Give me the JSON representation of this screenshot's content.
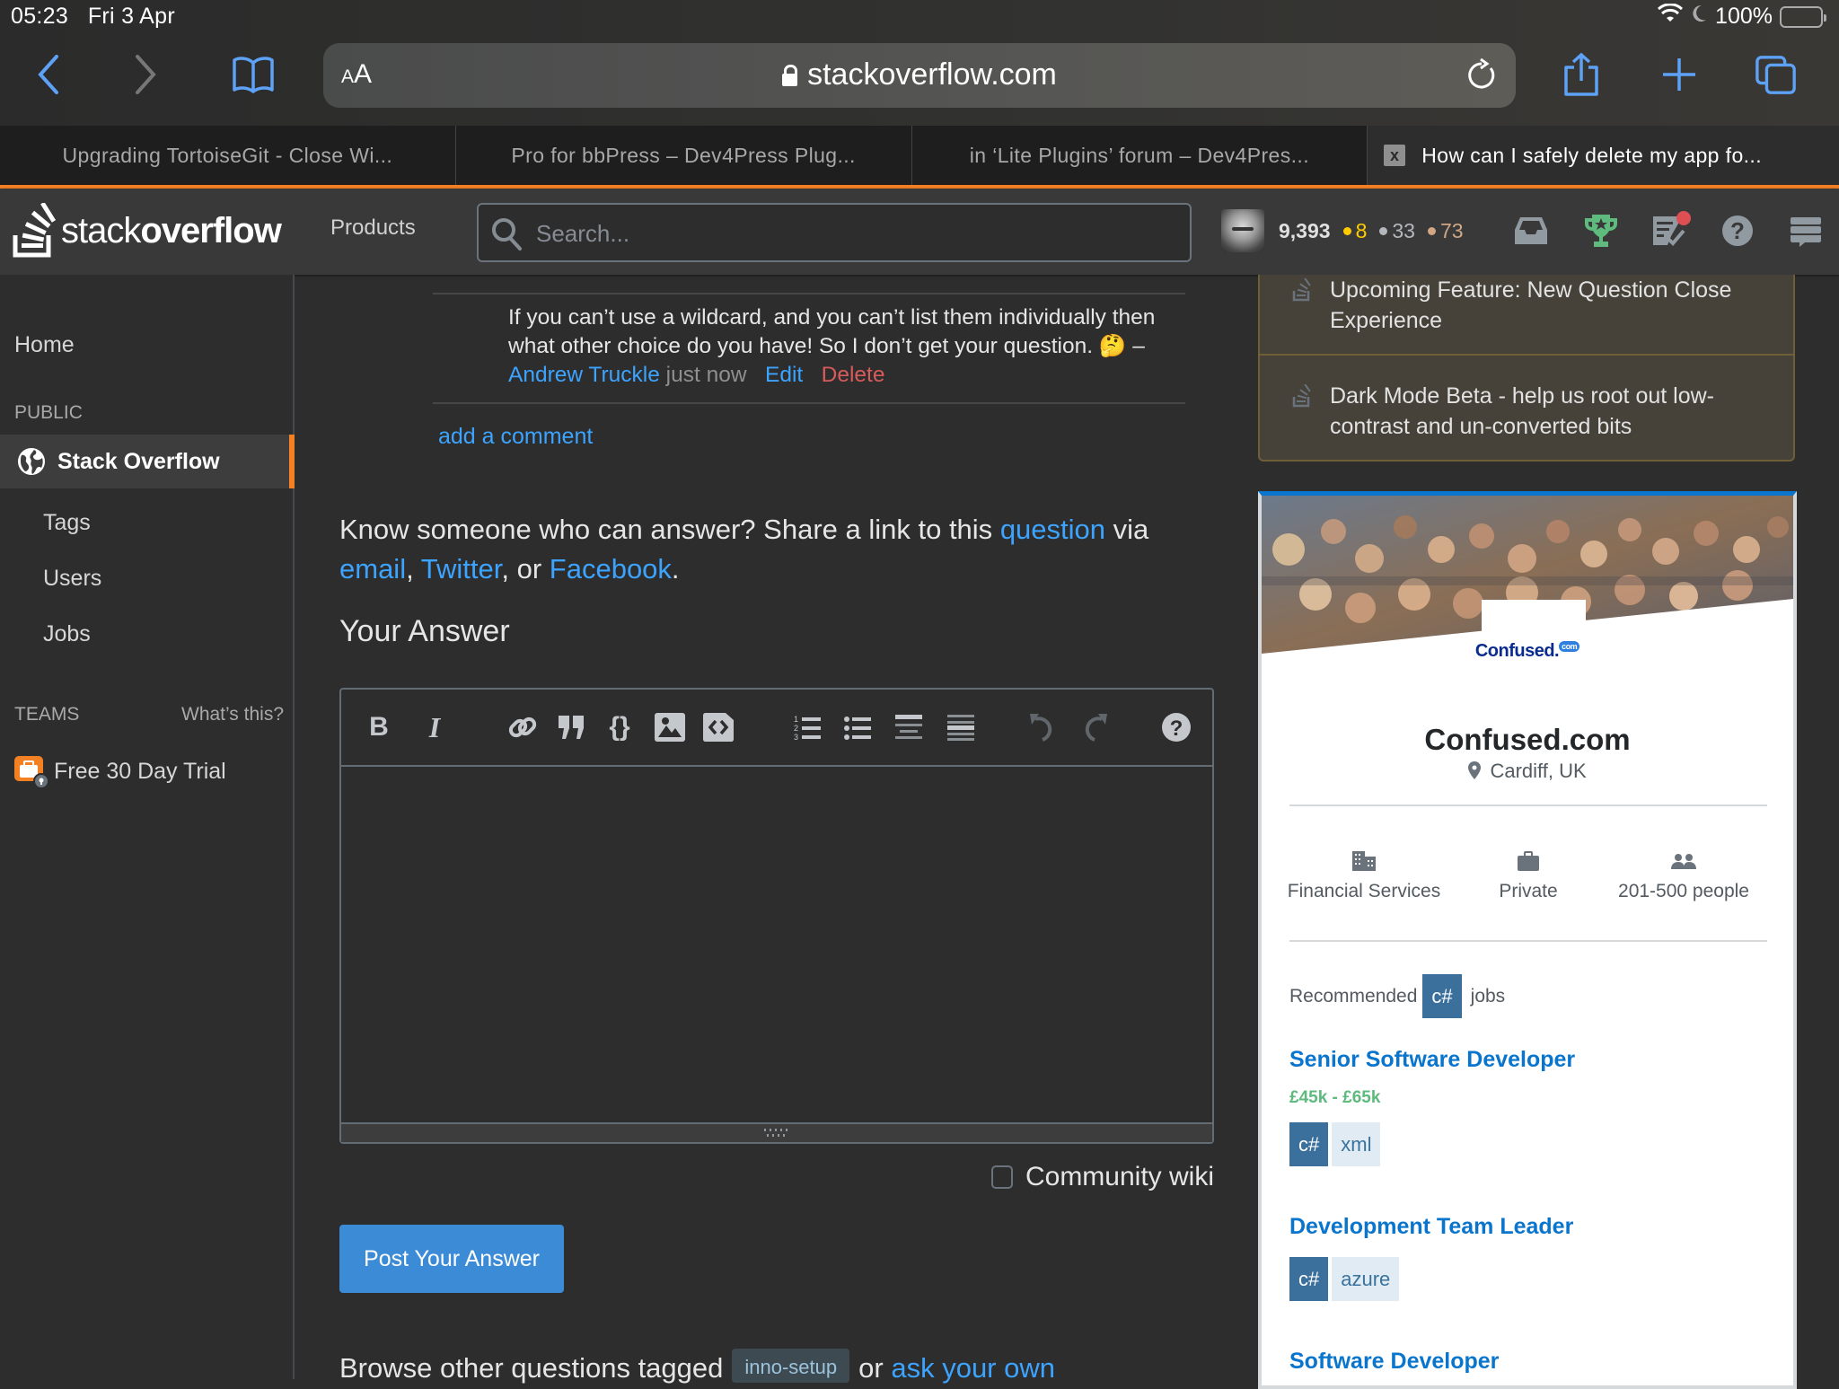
{
  "status_bar": {
    "time": "05:23",
    "date": "Fri 3 Apr",
    "battery": "100%",
    "battery_level": 1.0
  },
  "browser": {
    "text_size_label": "AA",
    "url": "stackoverflow.com",
    "tabs": [
      {
        "title": "Upgrading TortoiseGit - Close Wi..."
      },
      {
        "title": "Pro for bbPress – Dev4Press Plug..."
      },
      {
        "title": "in ‘Lite Plugins’ forum – Dev4Pres..."
      },
      {
        "title": "How can I safely delete my app fo...",
        "active": true
      }
    ],
    "close_tab_glyph": "x"
  },
  "header": {
    "logo_light": "stack",
    "logo_bold": "overflow",
    "products": "Products",
    "search_placeholder": "Search...",
    "reputation": "9,393",
    "gold_badges": "8",
    "silver_badges": "33",
    "bronze_badges": "73",
    "colors": {
      "gold": "#ffcc01",
      "silver": "#b4b8bc",
      "bronze": "#d1a684"
    }
  },
  "sidebar": {
    "home": "Home",
    "public_heading": "PUBLIC",
    "stack_overflow": "Stack Overflow",
    "tags": "Tags",
    "users": "Users",
    "jobs": "Jobs",
    "teams_heading": "TEAMS",
    "whats_this": "What’s this?",
    "free_trial": "Free 30 Day Trial"
  },
  "main": {
    "comment": {
      "text": "If you can’t use a wildcard, and you can’t list them individually then what other choice do you have! So I don’t get your question.",
      "emoji": "🤔",
      "dash": "–",
      "author": "Andrew Truckle",
      "time": "just now",
      "edit": "Edit",
      "delete": "Delete"
    },
    "add_comment": "add a comment",
    "share": {
      "prefix": "Know someone who can answer? Share a link to this",
      "question_link": "question",
      "via": "via",
      "email": "email",
      "twitter": "Twitter",
      "or": ", or",
      "facebook": "Facebook",
      "end": "."
    },
    "your_answer": "Your Answer",
    "editor": {
      "toolbar": [
        "bold",
        "italic",
        "link",
        "blockquote",
        "code",
        "image",
        "snippet",
        "ordered-list",
        "bulleted-list",
        "heading",
        "horizontal-rule",
        "undo",
        "redo",
        "help"
      ],
      "bold_glyph": "B",
      "italic_glyph": "I",
      "code_glyph": "{}",
      "help_glyph": "?",
      "content": ""
    },
    "community_wiki": "Community wiki",
    "post_answer": "Post Your Answer",
    "browse": {
      "prefix": "Browse other questions tagged",
      "tag": "inno-setup",
      "or": "or",
      "ask": "ask your own"
    }
  },
  "right": {
    "meta_posts": [
      {
        "title": "Upcoming Feature: New Question Close Experience"
      },
      {
        "title": "Dark Mode Beta - help us root out low-contrast and un-converted bits"
      }
    ],
    "company": {
      "logo_text": "Confused.",
      "logo_sup": "com",
      "name": "Confused.com",
      "location": "Cardiff, UK",
      "facts": [
        {
          "icon": "building-icon",
          "label": "Financial Services"
        },
        {
          "icon": "briefcase-icon",
          "label": "Private"
        },
        {
          "icon": "people-icon",
          "label": "201-500 people"
        }
      ],
      "recommended_prefix": "Recommended",
      "recommended_tag": "c#",
      "recommended_suffix": "jobs",
      "jobs": [
        {
          "title": "Senior Software Developer",
          "salary": "£45k - £65k",
          "tags": [
            "c#",
            "xml"
          ]
        },
        {
          "title": "Development Team Leader",
          "salary": "",
          "tags": [
            "c#",
            "azure"
          ]
        },
        {
          "title": "Software Developer",
          "salary": "",
          "tags": []
        }
      ]
    }
  }
}
